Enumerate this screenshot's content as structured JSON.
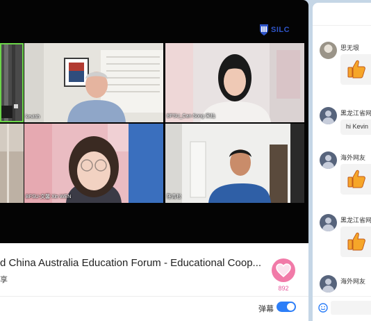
{
  "video": {
    "logo_text": "SILC",
    "participants": [
      {
        "name": ""
      },
      {
        "name": "kevinh"
      },
      {
        "name": "BFSU_Can Song 宋灿"
      },
      {
        "name": ""
      },
      {
        "name": "BFSU-文馨 Xin WEN"
      },
      {
        "name": "陈青松"
      }
    ]
  },
  "info": {
    "title": "d China Australia Education Forum - Educational Coop...",
    "subtitle": "享",
    "likes": "892",
    "danmaku_label": "弹幕",
    "danmaku_enabled": true
  },
  "chat": {
    "messages": [
      {
        "user": "思无垠",
        "type": "thumbs-up",
        "avatar": "photo"
      },
      {
        "user": "黑龙江省网",
        "type": "text",
        "text": "hi Kevin",
        "avatar": "default"
      },
      {
        "user": "海外网友",
        "type": "thumbs-up",
        "avatar": "default"
      },
      {
        "user": "黑龙江省网",
        "type": "thumbs-up",
        "avatar": "default"
      },
      {
        "user": "海外网友",
        "type": "thumbs-up",
        "avatar": "default"
      }
    ]
  },
  "colors": {
    "background": "#c5d6e6",
    "accent": "#2c7ef8",
    "like": "#f17aa8",
    "active_speaker": "#6cd64a"
  }
}
